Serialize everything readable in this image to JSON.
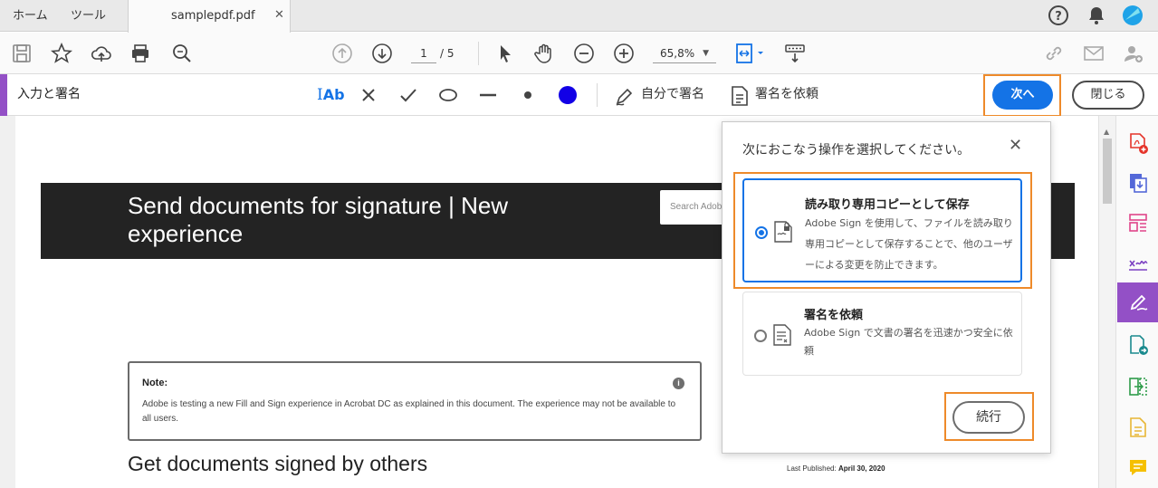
{
  "tabs": {
    "home": "ホーム",
    "tools": "ツール",
    "document": "samplepdf.pdf",
    "close_glyph": "✕"
  },
  "toolbar": {
    "page_current": "1",
    "page_total": "/ 5",
    "zoom": "65,8%"
  },
  "signbar": {
    "title": "入力と署名",
    "text_tool": "Ab",
    "sign_self": "自分で署名",
    "request_sign": "署名を依頼",
    "next_button": "次へ",
    "close_button": "閉じる",
    "color_dot": "#1200e6"
  },
  "document": {
    "banner_title": "Send documents for signature | New experience",
    "search_placeholder": "Search Adobe",
    "note_title": "Note:",
    "note_body": "Adobe is testing a new Fill and Sign experience in Acrobat DC as explained in this document. The experience may not be available to all users.",
    "heading": "Get documents signed by others",
    "last_published_label": "Last Published:",
    "last_published_date": "April 30, 2020"
  },
  "popover": {
    "title": "次におこなう操作を選択してください。",
    "options": [
      {
        "title": "読み取り専用コピーとして保存",
        "desc": "Adobe Sign を使用して、ファイルを読み取り専用コピーとして保存することで、他のユーザーによる変更を防止できます。",
        "selected": true
      },
      {
        "title": "署名を依頼",
        "desc": "Adobe Sign で文書の署名を迅速かつ安全に依頼",
        "selected": false
      }
    ],
    "continue_button": "続行"
  },
  "colors": {
    "accent_purple": "#9350c6",
    "primary_blue": "#1473e6",
    "highlight_orange": "#ee8a2a"
  }
}
